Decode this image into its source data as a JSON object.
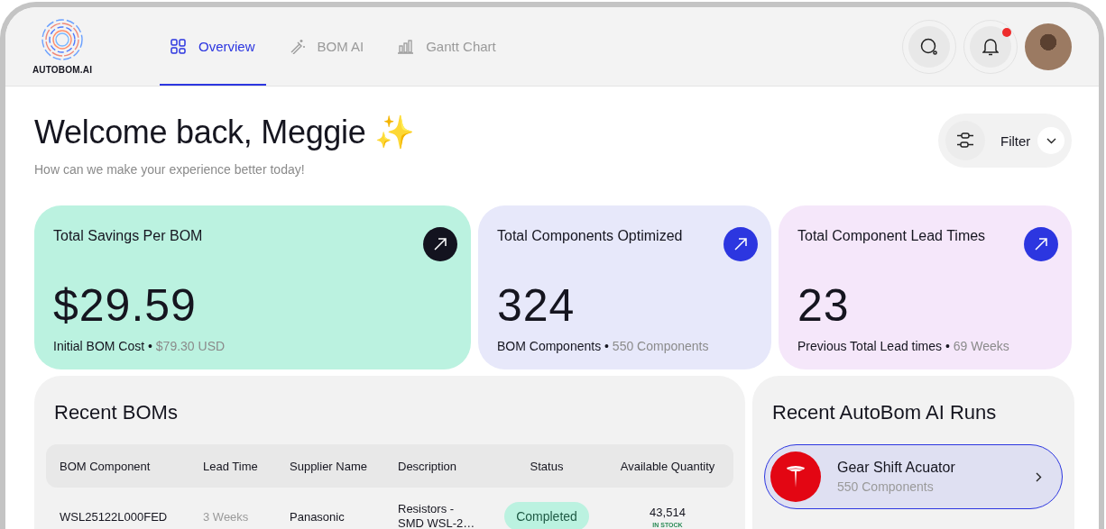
{
  "brand": {
    "name": "AUTOBOM.AI"
  },
  "tabs": [
    {
      "label": "Overview",
      "selected": true
    },
    {
      "label": "BOM AI",
      "selected": false
    },
    {
      "label": "Gantt Chart",
      "selected": false
    }
  ],
  "notifications": {
    "unread": true
  },
  "welcome": {
    "title": "Welcome back, Meggie",
    "emoji": "✨",
    "subtitle": "How can we make your experience better today!"
  },
  "filter": {
    "label": "Filter"
  },
  "stats": [
    {
      "title": "Total Savings Per BOM",
      "value": "$29.59",
      "caption": "Initial BOM Cost •",
      "detail": "$79.30 USD",
      "color": "#bbf2e0",
      "kind": "dark"
    },
    {
      "title": "Total Components Optimized",
      "value": "324",
      "caption": "BOM Components •",
      "detail": "550 Components",
      "color": "#e7e8fa",
      "kind": "accent"
    },
    {
      "title": "Total Component Lead Times",
      "value": "23",
      "caption": "Previous Total Lead times •",
      "detail": "69 Weeks",
      "color": "#f5e7fa",
      "kind": "accent"
    }
  ],
  "recent_boms": {
    "title": "Recent BOMs",
    "columns": [
      "BOM Component",
      "Lead Time",
      "Supplier Name",
      "Description",
      "Status",
      "Available Quantity"
    ],
    "rows": [
      {
        "component": "WSL25122L000FED",
        "lead_time": "3 Weeks",
        "supplier": "Panasonic",
        "description": "Resistors - SMD WSL-2…",
        "status": "Completed",
        "kind": "completed",
        "quantity": "43,514",
        "stock": "IN STOCK"
      }
    ]
  },
  "recent_runs": {
    "title": "Recent AutoBom AI Runs",
    "items": [
      {
        "name": "Gear Shift Acuator",
        "count": "550 Components",
        "selected": true
      }
    ]
  }
}
